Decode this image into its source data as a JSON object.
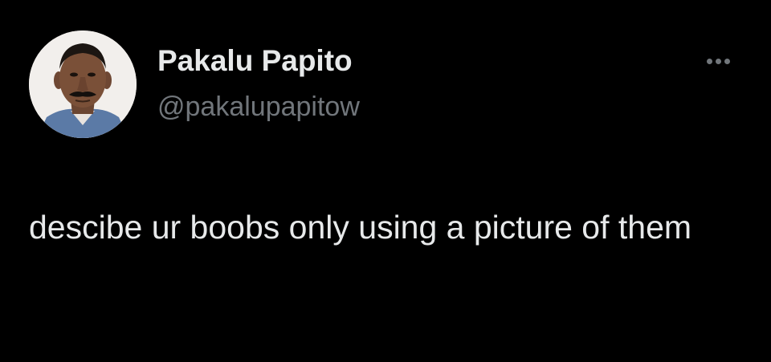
{
  "tweet": {
    "author_name": "Pakalu Papito",
    "author_handle": "@pakalupapitow",
    "text": "descibe ur boobs only using a picture of them",
    "more_icon": "more-options-icon",
    "avatar_icon": "profile-photo"
  },
  "colors": {
    "background": "#000000",
    "primary_text": "#e7e9ea",
    "secondary_text": "#71767b"
  }
}
